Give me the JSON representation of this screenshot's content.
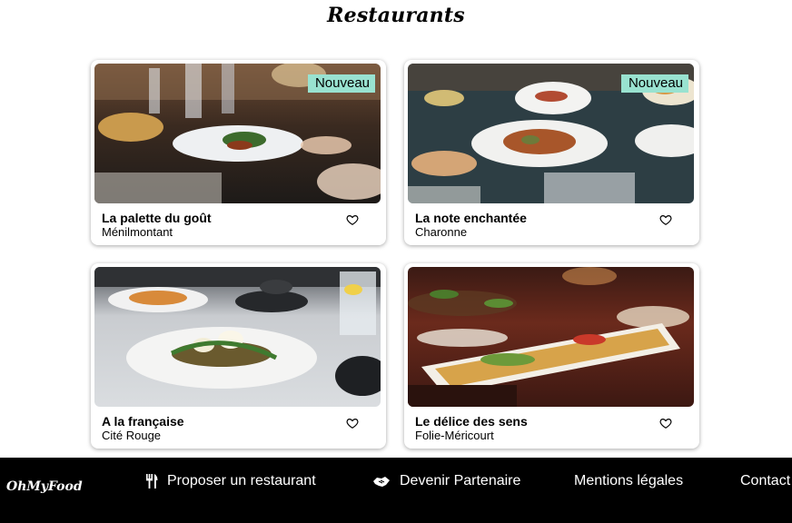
{
  "page": {
    "title": "Restaurants"
  },
  "restaurants": [
    {
      "name": "La palette du goût",
      "area": "Ménilmontant",
      "badge": "Nouveau"
    },
    {
      "name": "La note enchantée",
      "area": "Charonne",
      "badge": "Nouveau"
    },
    {
      "name": "A la française",
      "area": "Cité Rouge",
      "badge": ""
    },
    {
      "name": "Le délice des sens",
      "area": "Folie-Méricourt",
      "badge": ""
    }
  ],
  "footer": {
    "logo": "OhMyFood",
    "links": [
      {
        "label": "Proposer un restaurant",
        "icon": "utensils-icon"
      },
      {
        "label": "Devenir Partenaire",
        "icon": "handshake-icon"
      },
      {
        "label": "Mentions légales",
        "icon": ""
      },
      {
        "label": "Contact",
        "icon": ""
      }
    ]
  },
  "colors": {
    "badge": "#99e2d0",
    "footer_bg": "#000000"
  }
}
